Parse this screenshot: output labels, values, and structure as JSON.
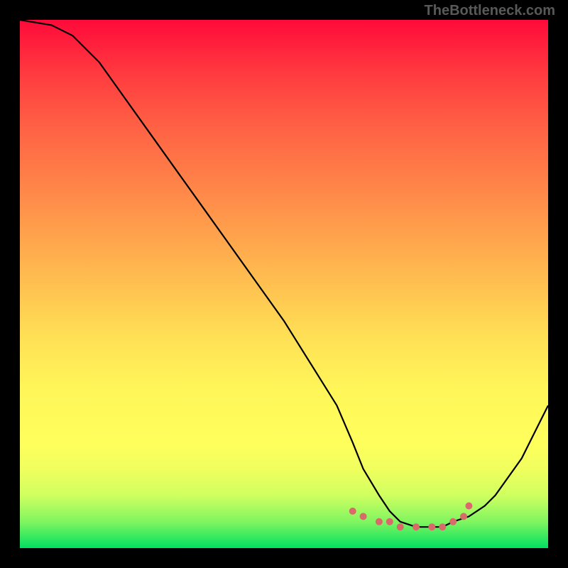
{
  "watermark": "TheBottleneck.com",
  "chart_data": {
    "type": "line",
    "title": "",
    "xlabel": "",
    "ylabel": "",
    "xlim": [
      0,
      100
    ],
    "ylim": [
      0,
      100
    ],
    "series": [
      {
        "name": "curve",
        "x": [
          0,
          6,
          10,
          15,
          20,
          25,
          30,
          35,
          40,
          45,
          50,
          55,
          60,
          63,
          65,
          68,
          70,
          72,
          75,
          78,
          80,
          82,
          85,
          88,
          90,
          95,
          100
        ],
        "values": [
          100,
          99,
          97,
          92,
          85,
          78,
          71,
          64,
          57,
          50,
          43,
          35,
          27,
          20,
          15,
          10,
          7,
          5,
          4,
          4,
          4,
          5,
          6,
          8,
          10,
          17,
          27
        ]
      }
    ],
    "markers": {
      "name": "dots",
      "x": [
        63,
        65,
        68,
        70,
        72,
        75,
        78,
        80,
        82,
        84,
        85
      ],
      "values": [
        7,
        6,
        5,
        5,
        4,
        4,
        4,
        4,
        5,
        6,
        8
      ]
    }
  }
}
